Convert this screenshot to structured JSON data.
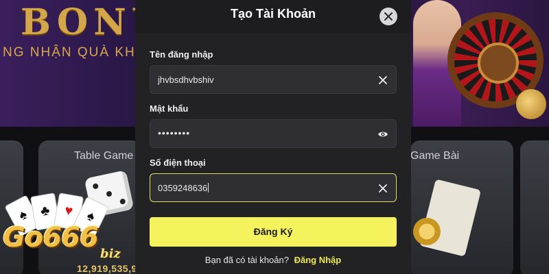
{
  "background": {
    "banner_heading": "BONU",
    "banner_subtext": "NG NHẬN QUÀ KHU",
    "card_titles": [
      "Table Game",
      "Game Bài"
    ],
    "jackpot_amount": "12,919,535,9",
    "logo_text": "Go666",
    "logo_suffix": "biz",
    "logo_card_symbols": [
      "♠",
      "♣",
      "♥",
      "♠"
    ]
  },
  "modal": {
    "title": "Tạo Tài Khoản",
    "close_icon": "close-icon",
    "fields": [
      {
        "label": "Tên đăng nhập",
        "value": "jhvbsdhvbshiv",
        "action_icon": "clear-icon",
        "type": "text"
      },
      {
        "label": "Mật khẩu",
        "value": "••••••••",
        "action_icon": "eye-icon",
        "type": "password"
      },
      {
        "label": "Số điện thoại",
        "value": "0359248636",
        "action_icon": "clear-icon",
        "type": "tel",
        "focused": true
      }
    ],
    "submit_label": "Đăng Ký",
    "footer_question": "Bạn đã có tài khoản?",
    "footer_link": "Đăng Nhập"
  },
  "colors": {
    "accent": "#f4f35e",
    "focus_border": "#dfe25c",
    "modal_bg": "#222225",
    "input_bg": "#2e2e33"
  }
}
